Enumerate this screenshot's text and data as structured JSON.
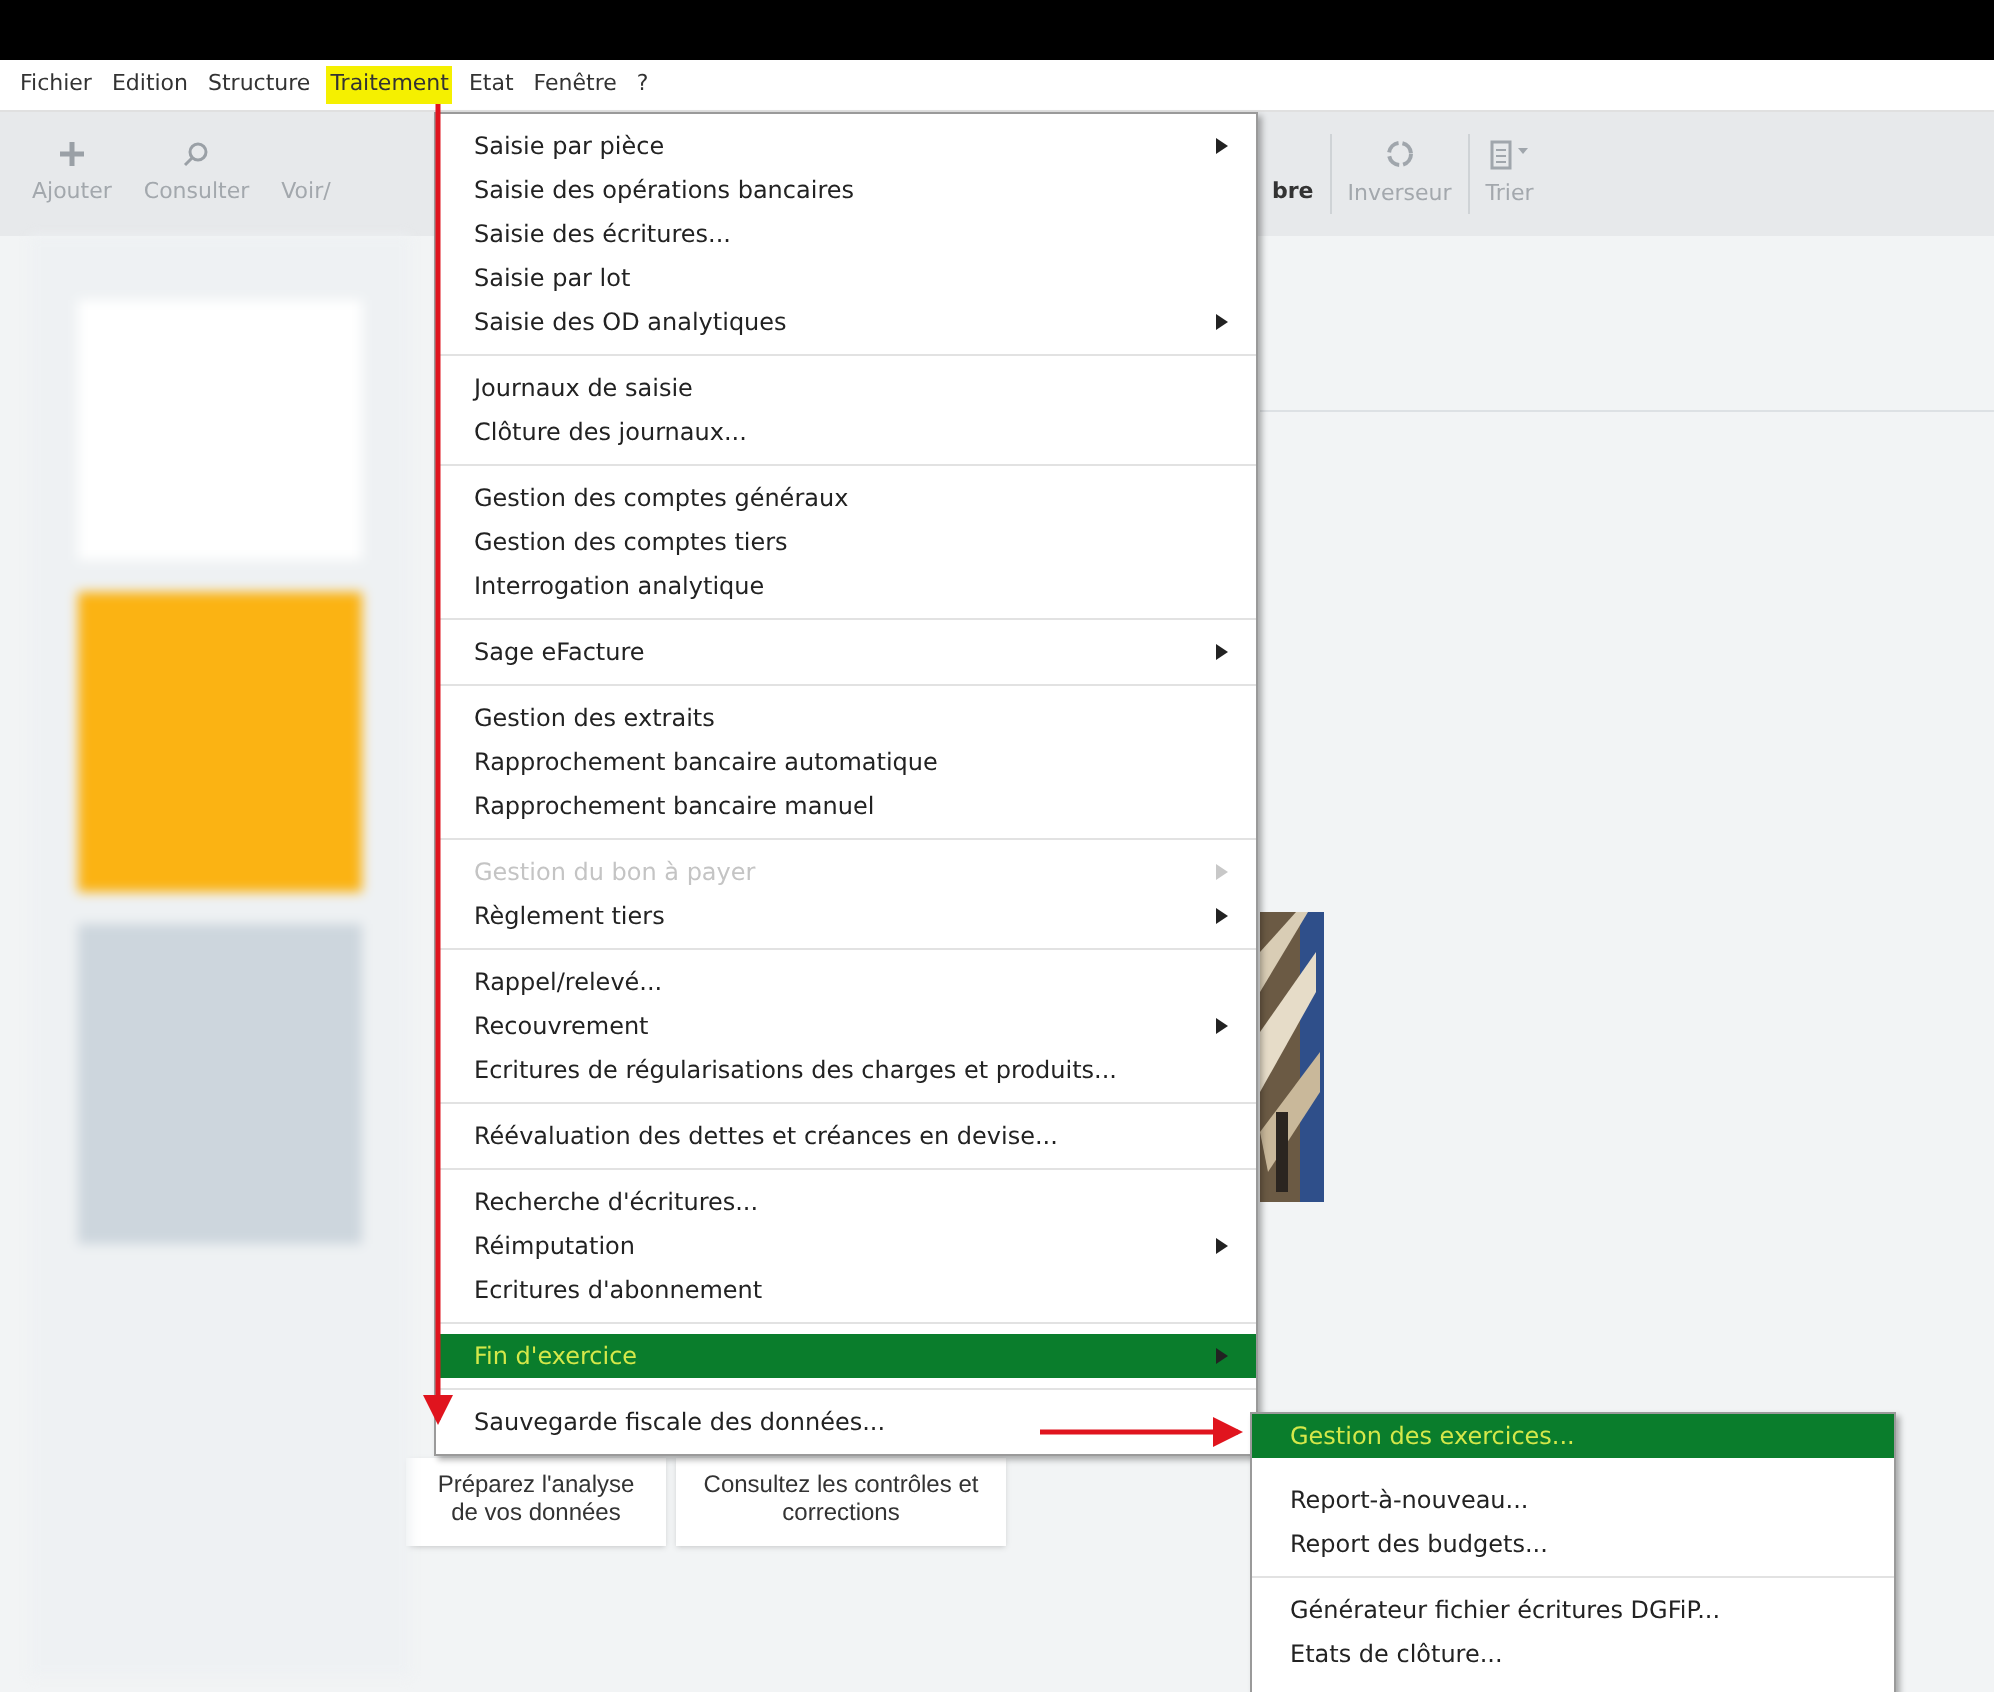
{
  "menubar": [
    {
      "label": "Fichier",
      "selected": false
    },
    {
      "label": "Edition",
      "selected": false
    },
    {
      "label": "Structure",
      "selected": false
    },
    {
      "label": "Traitement",
      "selected": true
    },
    {
      "label": "Etat",
      "selected": false
    },
    {
      "label": "Fenêtre",
      "selected": false
    },
    {
      "label": "?",
      "selected": false
    }
  ],
  "toolbar": [
    {
      "label": "Ajouter",
      "kind": "plus"
    },
    {
      "label": "Consulter",
      "kind": "search"
    },
    {
      "label": "Voir/",
      "kind": "none"
    }
  ],
  "toolbar_right": [
    {
      "label": "bre",
      "kind": "bold"
    },
    {
      "label": "Inverseur",
      "kind": "circle"
    },
    {
      "label": "Trier",
      "kind": "clipboard"
    }
  ],
  "menu": [
    [
      {
        "label": "Saisie par pièce",
        "submenu": true,
        "disabled": false,
        "selected": false
      },
      {
        "label": "Saisie des opérations bancaires",
        "submenu": false,
        "disabled": false,
        "selected": false
      },
      {
        "label": "Saisie des écritures...",
        "submenu": false,
        "disabled": false,
        "selected": false
      },
      {
        "label": "Saisie par lot",
        "submenu": false,
        "disabled": false,
        "selected": false
      },
      {
        "label": "Saisie des OD analytiques",
        "submenu": true,
        "disabled": false,
        "selected": false
      }
    ],
    [
      {
        "label": "Journaux de saisie",
        "submenu": false,
        "disabled": false,
        "selected": false
      },
      {
        "label": "Clôture des journaux...",
        "submenu": false,
        "disabled": false,
        "selected": false
      }
    ],
    [
      {
        "label": "Gestion des comptes généraux",
        "submenu": false,
        "disabled": false,
        "selected": false
      },
      {
        "label": "Gestion des comptes tiers",
        "submenu": false,
        "disabled": false,
        "selected": false
      },
      {
        "label": "Interrogation analytique",
        "submenu": false,
        "disabled": false,
        "selected": false
      }
    ],
    [
      {
        "label": "Sage eFacture",
        "submenu": true,
        "disabled": false,
        "selected": false
      }
    ],
    [
      {
        "label": "Gestion des extraits",
        "submenu": false,
        "disabled": false,
        "selected": false
      },
      {
        "label": "Rapprochement bancaire automatique",
        "submenu": false,
        "disabled": false,
        "selected": false
      },
      {
        "label": "Rapprochement bancaire manuel",
        "submenu": false,
        "disabled": false,
        "selected": false
      }
    ],
    [
      {
        "label": "Gestion du bon à payer",
        "submenu": true,
        "disabled": true,
        "selected": false
      },
      {
        "label": "Règlement tiers",
        "submenu": true,
        "disabled": false,
        "selected": false
      }
    ],
    [
      {
        "label": "Rappel/relevé...",
        "submenu": false,
        "disabled": false,
        "selected": false
      },
      {
        "label": "Recouvrement",
        "submenu": true,
        "disabled": false,
        "selected": false
      },
      {
        "label": "Ecritures de régularisations des charges et produits...",
        "submenu": false,
        "disabled": false,
        "selected": false
      }
    ],
    [
      {
        "label": "Réévaluation des dettes et créances en devise...",
        "submenu": false,
        "disabled": false,
        "selected": false
      }
    ],
    [
      {
        "label": "Recherche d'écritures...",
        "submenu": false,
        "disabled": false,
        "selected": false
      },
      {
        "label": "Réimputation",
        "submenu": true,
        "disabled": false,
        "selected": false
      },
      {
        "label": "Ecritures d'abonnement",
        "submenu": false,
        "disabled": false,
        "selected": false
      }
    ],
    [
      {
        "label": "Fin d'exercice",
        "submenu": true,
        "disabled": false,
        "selected": true
      }
    ],
    [
      {
        "label": "Sauvegarde fiscale des données...",
        "submenu": false,
        "disabled": false,
        "selected": false
      }
    ]
  ],
  "submenu": [
    [
      {
        "label": "Gestion des exercices...",
        "selected": true
      },
      {
        "label": "Report-à-nouveau...",
        "selected": false
      },
      {
        "label": "Report des budgets...",
        "selected": false
      }
    ],
    [
      {
        "label": "Générateur fichier écritures DGFiP...",
        "selected": false
      },
      {
        "label": "Etats de clôture...",
        "selected": false
      }
    ]
  ],
  "cards": [
    "Préparez l'analyse de vos données",
    "Consultez les contrôles et corrections"
  ]
}
